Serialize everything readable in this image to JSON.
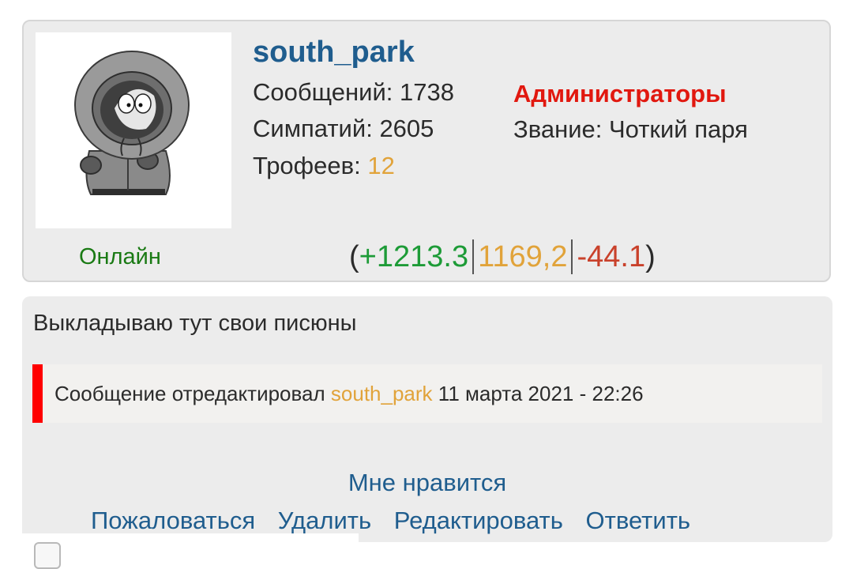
{
  "profile": {
    "username": "south_park",
    "avatar_icon": "kenny-avatar-icon",
    "stats": {
      "messages_label": "Сообщений:",
      "messages_value": "1738",
      "likes_label": "Симпатий:",
      "likes_value": "2605",
      "trophies_label": "Трофеев:",
      "trophies_value": "12"
    },
    "role": "Администраторы",
    "rank": "Звание: Чоткий паря",
    "status": "Онлайн",
    "rating": {
      "open": "(",
      "positive": "+1213.3",
      "total": "1169,2",
      "negative": "-44.1",
      "close": ")"
    }
  },
  "post": {
    "text": "Выкладываю тут свои писюны",
    "edit_note": {
      "prefix": "Сообщение отредактировал",
      "user": "south_park",
      "date": "11 марта 2021 - 22:26"
    },
    "like_label": "Мне нравится",
    "actions": {
      "report": "Пожаловаться",
      "delete": "Удалить",
      "edit": "Редактировать",
      "reply": "Ответить"
    }
  },
  "colors": {
    "username": "#1f5d8e",
    "online": "#1a7a14",
    "admin": "#e1180f",
    "accent_orange": "#e1a33a",
    "positive": "#1d9b37",
    "negative": "#c9412b",
    "edit_bar": "#ff0000"
  }
}
